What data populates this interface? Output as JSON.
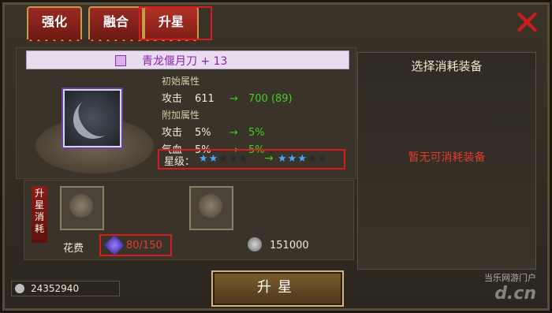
{
  "tabs": [
    {
      "label": "强化"
    },
    {
      "label": "融合"
    },
    {
      "label": "升星"
    }
  ],
  "item": {
    "name": "青龙偃月刀 + 13"
  },
  "stats": {
    "base_title": "初始属性",
    "base": [
      {
        "key": "攻击",
        "value": "611",
        "arrow": "→",
        "new_value": "700 (89)"
      }
    ],
    "bonus_title": "附加属性",
    "bonus": [
      {
        "key": "攻击",
        "value": "5%",
        "arrow": "→",
        "new_value": "5%"
      },
      {
        "key": "气血",
        "value": "5%",
        "arrow": "→",
        "new_value": "5%"
      }
    ],
    "star_label": "星级：",
    "stars_current": "★★★★★",
    "stars_next": "★★★★★",
    "stars_current_filled": 2,
    "stars_next_filled": 3,
    "star_arrow": "→"
  },
  "right_panel": {
    "title": "选择消耗装备",
    "empty_text": "暂无可消耗装备"
  },
  "cost": {
    "tag": "升星消耗",
    "fee_label": "花费",
    "gem_value": "80/150",
    "coin_value": "151000"
  },
  "money": {
    "value": "24352940"
  },
  "button": {
    "label": "升星"
  },
  "watermark": {
    "line1": "当乐网游门户",
    "line2": "d.cn"
  },
  "colors": {
    "accent": "#d81b1b",
    "green": "#3ed11f",
    "purple": "#8b1eb4",
    "blue_star": "#48a6ff"
  }
}
